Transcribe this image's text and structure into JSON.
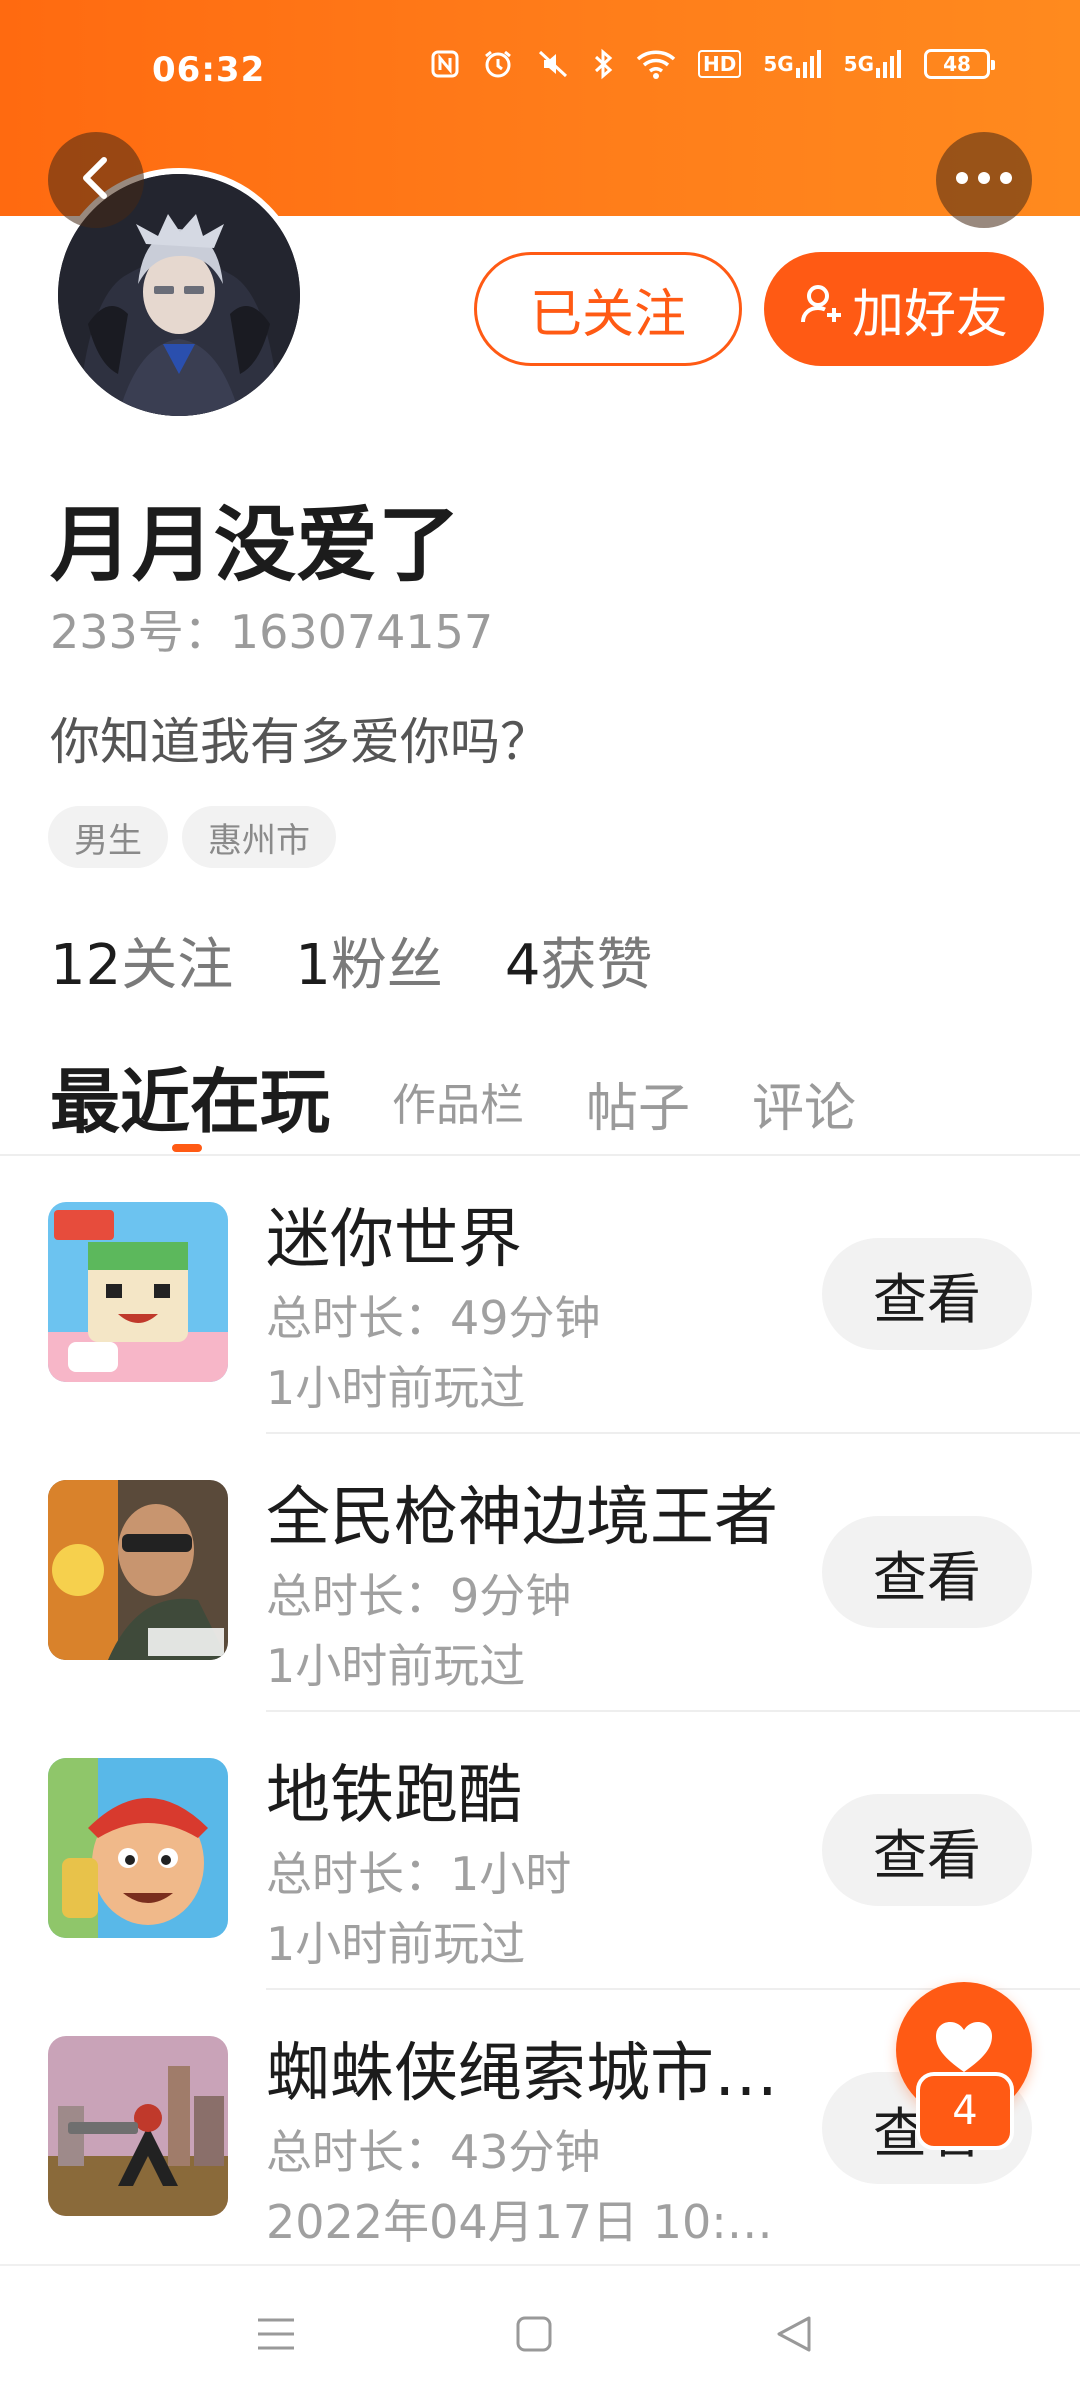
{
  "status_bar": {
    "time": "06:32",
    "icons": [
      "nfc-icon",
      "alarm-icon",
      "mute-icon",
      "bluetooth-icon",
      "wifi-icon",
      "hd-icon",
      "signal-5g-icon",
      "signal-5g-icon"
    ],
    "hd_label": "HD",
    "net_label": "5G",
    "battery": "48"
  },
  "header": {
    "back_icon": "chevron-left-icon",
    "more_icon": "more-dots-icon",
    "gradient_start": "#ff6a10",
    "gradient_end": "#ff8a1e"
  },
  "profile": {
    "name": "月月没爱了",
    "id_text": "233号：163074157",
    "bio": "你知道我有多爱你吗？",
    "tags": [
      "男生",
      "惠州市"
    ],
    "followed_label": "已关注",
    "add_friend_label": "加好友",
    "accent_color": "#ff5a14"
  },
  "stats": [
    {
      "num": "12",
      "label": "关注"
    },
    {
      "num": "1",
      "label": "粉丝"
    },
    {
      "num": "4",
      "label": "获赞"
    }
  ],
  "tabs": [
    {
      "label": "最近在玩",
      "active": true
    },
    {
      "label": "作品栏",
      "active": false
    },
    {
      "label": "帖子",
      "active": false
    },
    {
      "label": "评论",
      "active": false
    }
  ],
  "games": [
    {
      "name": "迷你世界",
      "duration": "总时长：49分钟",
      "last_played": "1小时前玩过",
      "button": "查看"
    },
    {
      "name": "全民枪神边境王者",
      "duration": "总时长：9分钟",
      "last_played": "1小时前玩过",
      "button": "查看"
    },
    {
      "name": "地铁跑酷",
      "duration": "总时长：1小时",
      "last_played": "1小时前玩过",
      "button": "查看"
    },
    {
      "name": "蜘蛛侠绳索城市…",
      "duration": "总时长：43分钟",
      "last_played": "2022年04月17日 10:4…",
      "button": "查看"
    }
  ],
  "fab": {
    "icon": "heart-icon",
    "count": "4"
  },
  "nav_bar": {
    "icons": [
      "menu-icon",
      "home-square-icon",
      "back-triangle-icon"
    ]
  }
}
